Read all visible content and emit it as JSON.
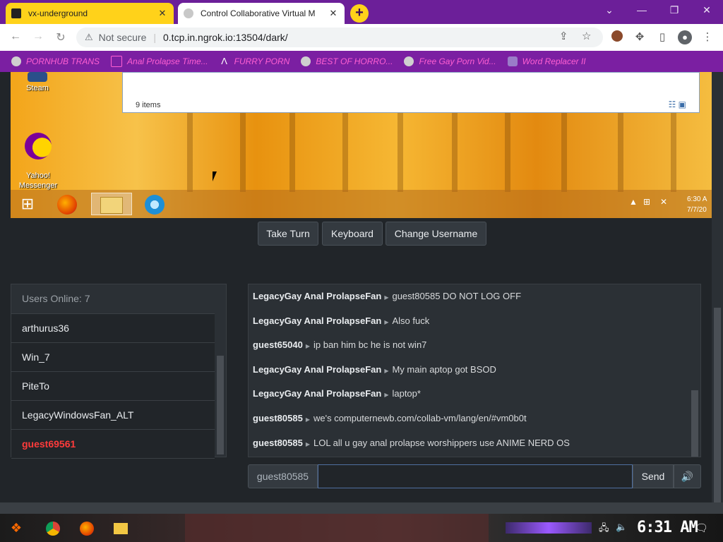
{
  "browser": {
    "tabs": [
      {
        "title": "vx-underground",
        "active": false
      },
      {
        "title": "Control Collaborative Virtual M",
        "active": true
      }
    ],
    "new_tab_label": "+",
    "address": {
      "security_label": "Not secure",
      "host": "0.tcp.in.ngrok.io",
      "path": ":13504/dark/"
    },
    "bookmarks": [
      "PORNHUB TRANS",
      "Anal Prolapse Time...",
      "FURRY PORN",
      "BEST OF HORRO...",
      "Free Gay Porn Vid...",
      "Word Replacer II"
    ]
  },
  "vm": {
    "explorer_status": "9 items",
    "desktop_icons": [
      {
        "label": "Steam"
      },
      {
        "label": "Yahoo!\nMessenger"
      }
    ],
    "clock": {
      "time": "6:30 A",
      "date": "7/7/20"
    }
  },
  "controls": {
    "take_turn": "Take Turn",
    "keyboard": "Keyboard",
    "change_username": "Change Username"
  },
  "users": {
    "header": "Users Online: 7",
    "list": [
      {
        "name": "arthurus36",
        "me": false
      },
      {
        "name": "Win_7",
        "me": false
      },
      {
        "name": "PiteTo",
        "me": false
      },
      {
        "name": "LegacyWindowsFan_ALT",
        "me": false
      },
      {
        "name": "guest69561",
        "me": true
      }
    ]
  },
  "chat": {
    "messages": [
      {
        "user": "LegacyGay Anal ProlapseFan",
        "text": "guest80585 DO NOT LOG OFF"
      },
      {
        "user": "LegacyGay Anal ProlapseFan",
        "text": "Also fuck"
      },
      {
        "user": "guest65040",
        "text": "ip ban him bc he is not win7"
      },
      {
        "user": "LegacyGay Anal ProlapseFan",
        "text": "My main aptop got BSOD"
      },
      {
        "user": "LegacyGay Anal ProlapseFan",
        "text": "laptop*"
      },
      {
        "user": "guest80585",
        "text": "we's computernewb.com/collab-vm/lang/en/#vm0b0t"
      },
      {
        "user": "guest80585",
        "text": "LOL all u gay anal prolapse worshippers use ANIME NERD OS"
      }
    ],
    "username": "guest80585",
    "input_value": "",
    "send_label": "Send"
  },
  "host": {
    "clock": "6:31 AM"
  },
  "colors": {
    "tabbar": "#6c1f99",
    "bookmarks_bar": "#7b1fa2",
    "bookmark_text": "#ff5fd2",
    "active_user": "#ff3b3b"
  }
}
